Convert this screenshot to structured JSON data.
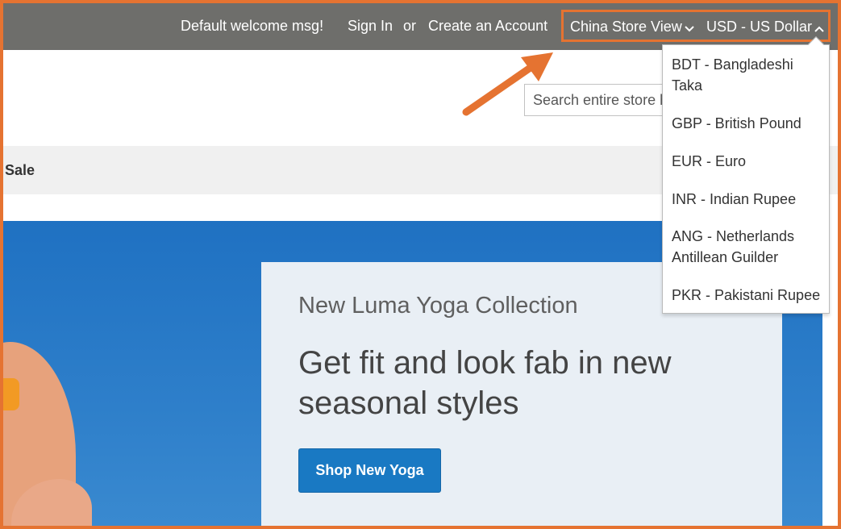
{
  "header": {
    "welcome": "Default welcome msg!",
    "sign_in": "Sign In",
    "or": "or",
    "create_account": "Create an Account",
    "store_view": "China Store View",
    "currency": "USD - US Dollar"
  },
  "search": {
    "placeholder": "Search entire store here..."
  },
  "nav": {
    "sale": "Sale"
  },
  "hero": {
    "subtitle": "New Luma Yoga Collection",
    "title": "Get fit and look fab in new seasonal styles",
    "button": "Shop New Yoga"
  },
  "currency_options": [
    "BDT - Bangladeshi Taka",
    "GBP - British Pound",
    "EUR - Euro",
    "INR - Indian Rupee",
    "ANG - Netherlands Antillean Guilder",
    "PKR - Pakistani Rupee"
  ],
  "colors": {
    "highlight": "#e57331",
    "header_bg": "#6e6e6b",
    "button": "#1979c3"
  }
}
